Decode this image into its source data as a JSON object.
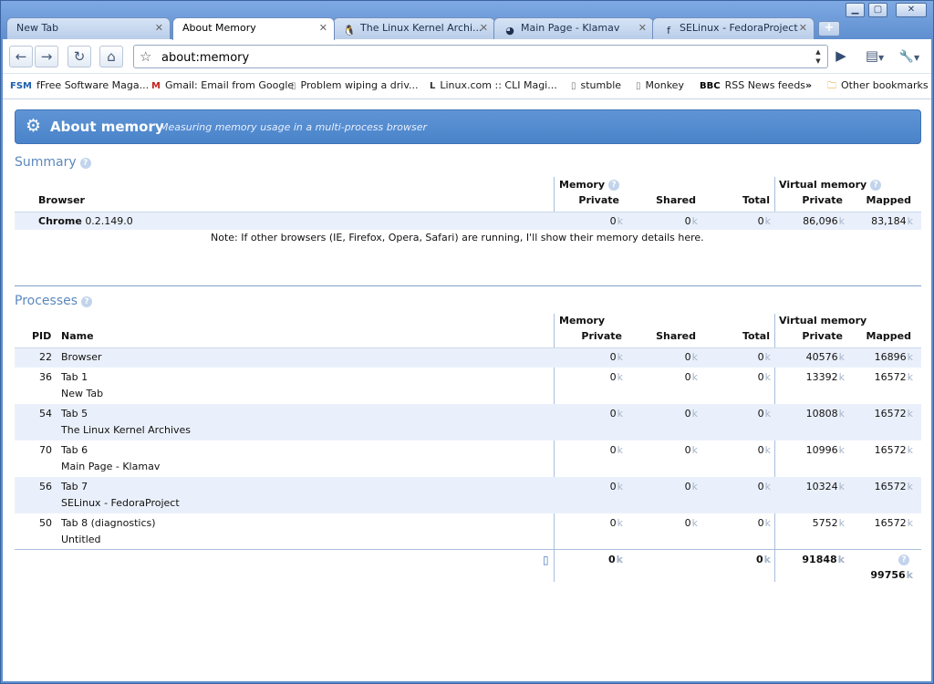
{
  "window": {
    "minimize": "▁",
    "maximize": "▢",
    "close": "✕"
  },
  "tabs": [
    {
      "title": "New Tab",
      "icon": "blank-page-icon",
      "glyph": "",
      "active": false
    },
    {
      "title": "About Memory",
      "icon": "blank-page-icon",
      "glyph": "",
      "active": true
    },
    {
      "title": "The Linux Kernel Archi...",
      "icon": "penguin-icon",
      "glyph": "🐧",
      "active": false
    },
    {
      "title": "Main Page - Klamav",
      "icon": "klamav-icon",
      "glyph": "◕",
      "active": false
    },
    {
      "title": "SELinux - FedoraProject",
      "icon": "fedora-icon",
      "glyph": "f",
      "active": false
    }
  ],
  "toolbar": {
    "back": "←",
    "forward": "→",
    "reload": "↻",
    "home": "⌂",
    "star": "☆",
    "url": "about:memory",
    "go": "▶",
    "page": "▤",
    "wrench": "🔧"
  },
  "bookmarks": [
    {
      "label": "fFree Software Maga...",
      "icon": "fsm-icon",
      "glyph": "FSM"
    },
    {
      "label": "Gmail: Email from Google",
      "icon": "gmail-icon",
      "glyph": "M"
    },
    {
      "label": "Problem wiping a driv...",
      "icon": "page-icon",
      "glyph": "▯"
    },
    {
      "label": "Linux.com :: CLI Magi...",
      "icon": "linuxcom-icon",
      "glyph": "L"
    },
    {
      "label": "stumble",
      "icon": "page-icon",
      "glyph": "▯"
    },
    {
      "label": "Monkey",
      "icon": "page-icon",
      "glyph": "▯"
    },
    {
      "label": "RSS News feeds",
      "icon": "bbc-icon",
      "glyph": "BBC"
    }
  ],
  "bookmarks_more": "»",
  "bookmarks_other": "Other bookmarks",
  "banner": {
    "title": "About memory",
    "subtitle": "Measuring memory usage in a multi-process browser"
  },
  "summary": {
    "title": "Summary",
    "help": "?",
    "headers": {
      "browser": "Browser",
      "memory": "Memory",
      "private": "Private",
      "shared": "Shared",
      "total": "Total",
      "virtual": "Virtual memory",
      "vprivate": "Private",
      "mapped": "Mapped"
    },
    "row": {
      "name": "Chrome",
      "version": "0.2.149.0",
      "private": "0",
      "shared": "0",
      "total": "0",
      "vprivate": "86,096",
      "mapped": "83,184"
    },
    "unit": "k",
    "note": "Note: If other browsers (IE, Firefox, Opera, Safari) are running, I'll show their memory details here."
  },
  "processes": {
    "title": "Processes",
    "help": "?",
    "headers": {
      "pid": "PID",
      "name": "Name",
      "memory": "Memory",
      "private": "Private",
      "shared": "Shared",
      "total": "Total",
      "virtual": "Virtual memory",
      "vprivate": "Private",
      "mapped": "Mapped"
    },
    "rows": [
      {
        "pid": "22",
        "name": "Browser",
        "sub": "",
        "private": "0",
        "shared": "0",
        "total": "0",
        "vprivate": "40576",
        "mapped": "16896"
      },
      {
        "pid": "36",
        "name": "Tab 1",
        "sub": "New Tab",
        "private": "0",
        "shared": "0",
        "total": "0",
        "vprivate": "13392",
        "mapped": "16572"
      },
      {
        "pid": "54",
        "name": "Tab 5",
        "sub": "The Linux Kernel Archives",
        "private": "0",
        "shared": "0",
        "total": "0",
        "vprivate": "10808",
        "mapped": "16572"
      },
      {
        "pid": "70",
        "name": "Tab 6",
        "sub": "Main Page - Klamav",
        "private": "0",
        "shared": "0",
        "total": "0",
        "vprivate": "10996",
        "mapped": "16572"
      },
      {
        "pid": "56",
        "name": "Tab 7",
        "sub": "SELinux - FedoraProject",
        "private": "0",
        "shared": "0",
        "total": "0",
        "vprivate": "10324",
        "mapped": "16572"
      },
      {
        "pid": "50",
        "name": "Tab 8 (diagnostics)",
        "sub": "Untitled",
        "private": "0",
        "shared": "0",
        "total": "0",
        "vprivate": "5752",
        "mapped": "16572"
      }
    ],
    "totals": {
      "marker": "▯",
      "private": "0",
      "total": "0",
      "vprivate": "91848",
      "mapped": "99756"
    },
    "unit": "k"
  }
}
